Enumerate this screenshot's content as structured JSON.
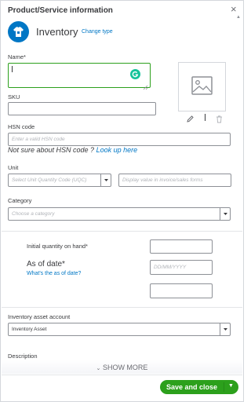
{
  "panel": {
    "title": "Product/Service information",
    "close_glyph": "×",
    "scroll_glyph": "▲",
    "type_name": "Inventory",
    "change_type": "Change type"
  },
  "name": {
    "label": "Name*",
    "value": ""
  },
  "sku": {
    "label": "SKU",
    "value": ""
  },
  "hsn": {
    "label": "HSN code",
    "placeholder": "Enter a valid HSN code",
    "help_prefix": "Not sure about HSN code ? ",
    "help_link": "Look up here"
  },
  "unit": {
    "label": "Unit",
    "select_placeholder": "Select Unit Quantity Code (UQC)",
    "display_placeholder": "Display value in invoice/sales forms"
  },
  "category": {
    "label": "Category",
    "placeholder": "Choose a category"
  },
  "initial_qty": {
    "label": "Initial quantity on hand*",
    "value": ""
  },
  "as_of": {
    "label": "As of date*",
    "help_link": "What's the as of date?",
    "placeholder": "DD/MM/YYYY",
    "extra_value": ""
  },
  "inventory_account": {
    "label": "Inventory asset account",
    "value": "Inventory Asset"
  },
  "description": {
    "label": "Description"
  },
  "footer": {
    "show_more": "SHOW MORE",
    "save": "Save and close"
  },
  "colors": {
    "accent": "#0077c5",
    "save_green": "#2ca01c",
    "name_focus": "#2ca01c",
    "grammarly": "#15c39a"
  },
  "icons": [
    "close-icon",
    "inventory-shirt-icon",
    "grammarly-icon",
    "image-placeholder-icon",
    "pencil-icon",
    "trash-icon",
    "chevron-down-icon"
  ]
}
